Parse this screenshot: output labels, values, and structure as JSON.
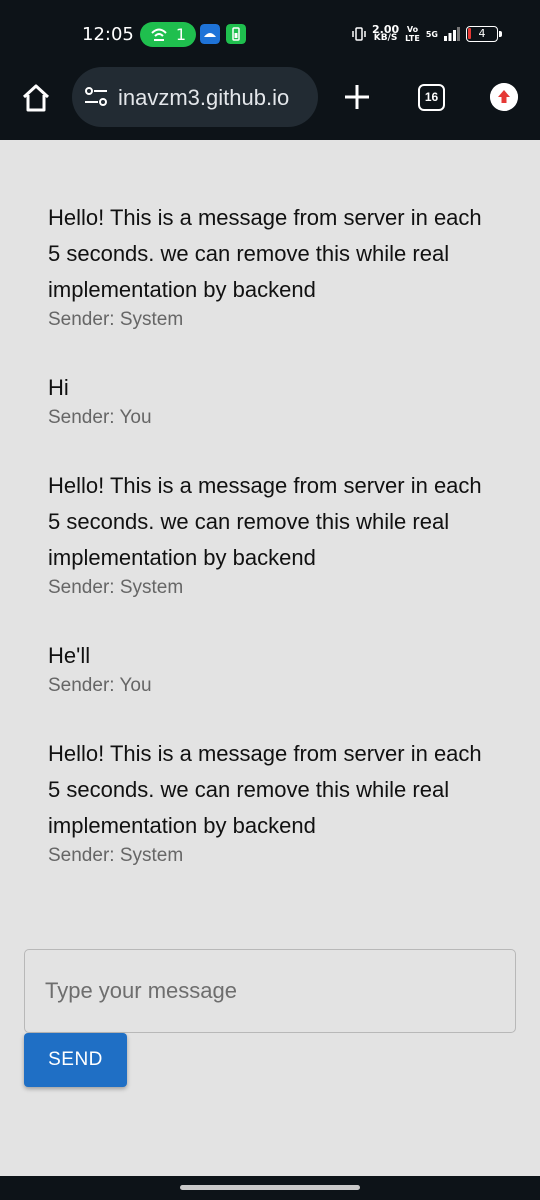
{
  "status_bar": {
    "time": "12:05",
    "hotspot_count": "1",
    "net_speed": "2.00",
    "net_unit": "KB/S",
    "volte": "Vo",
    "lte": "LTE",
    "network": "5G",
    "battery": "4"
  },
  "browser": {
    "url": "inavzm3.github.io",
    "tab_count": "16"
  },
  "messages": [
    {
      "text": "Hello! This is a message from server in each 5 seconds. we can remove this while real implementation by backend",
      "sender": "Sender: System"
    },
    {
      "text": "Hi",
      "sender": "Sender: You"
    },
    {
      "text": "Hello! This is a message from server in each 5 seconds. we can remove this while real implementation by backend",
      "sender": "Sender: System"
    },
    {
      "text": "He'll",
      "sender": "Sender: You"
    },
    {
      "text": "Hello! This is a message from server in each 5 seconds. we can remove this while real implementation by backend",
      "sender": "Sender: System"
    }
  ],
  "composer": {
    "placeholder": "Type your message",
    "value": "",
    "send_label": "SEND"
  },
  "colors": {
    "accent": "#1f6fc5",
    "chrome_bg": "#0d1318",
    "page_bg": "#e3e3e3",
    "hotspot": "#1fbf4e"
  }
}
